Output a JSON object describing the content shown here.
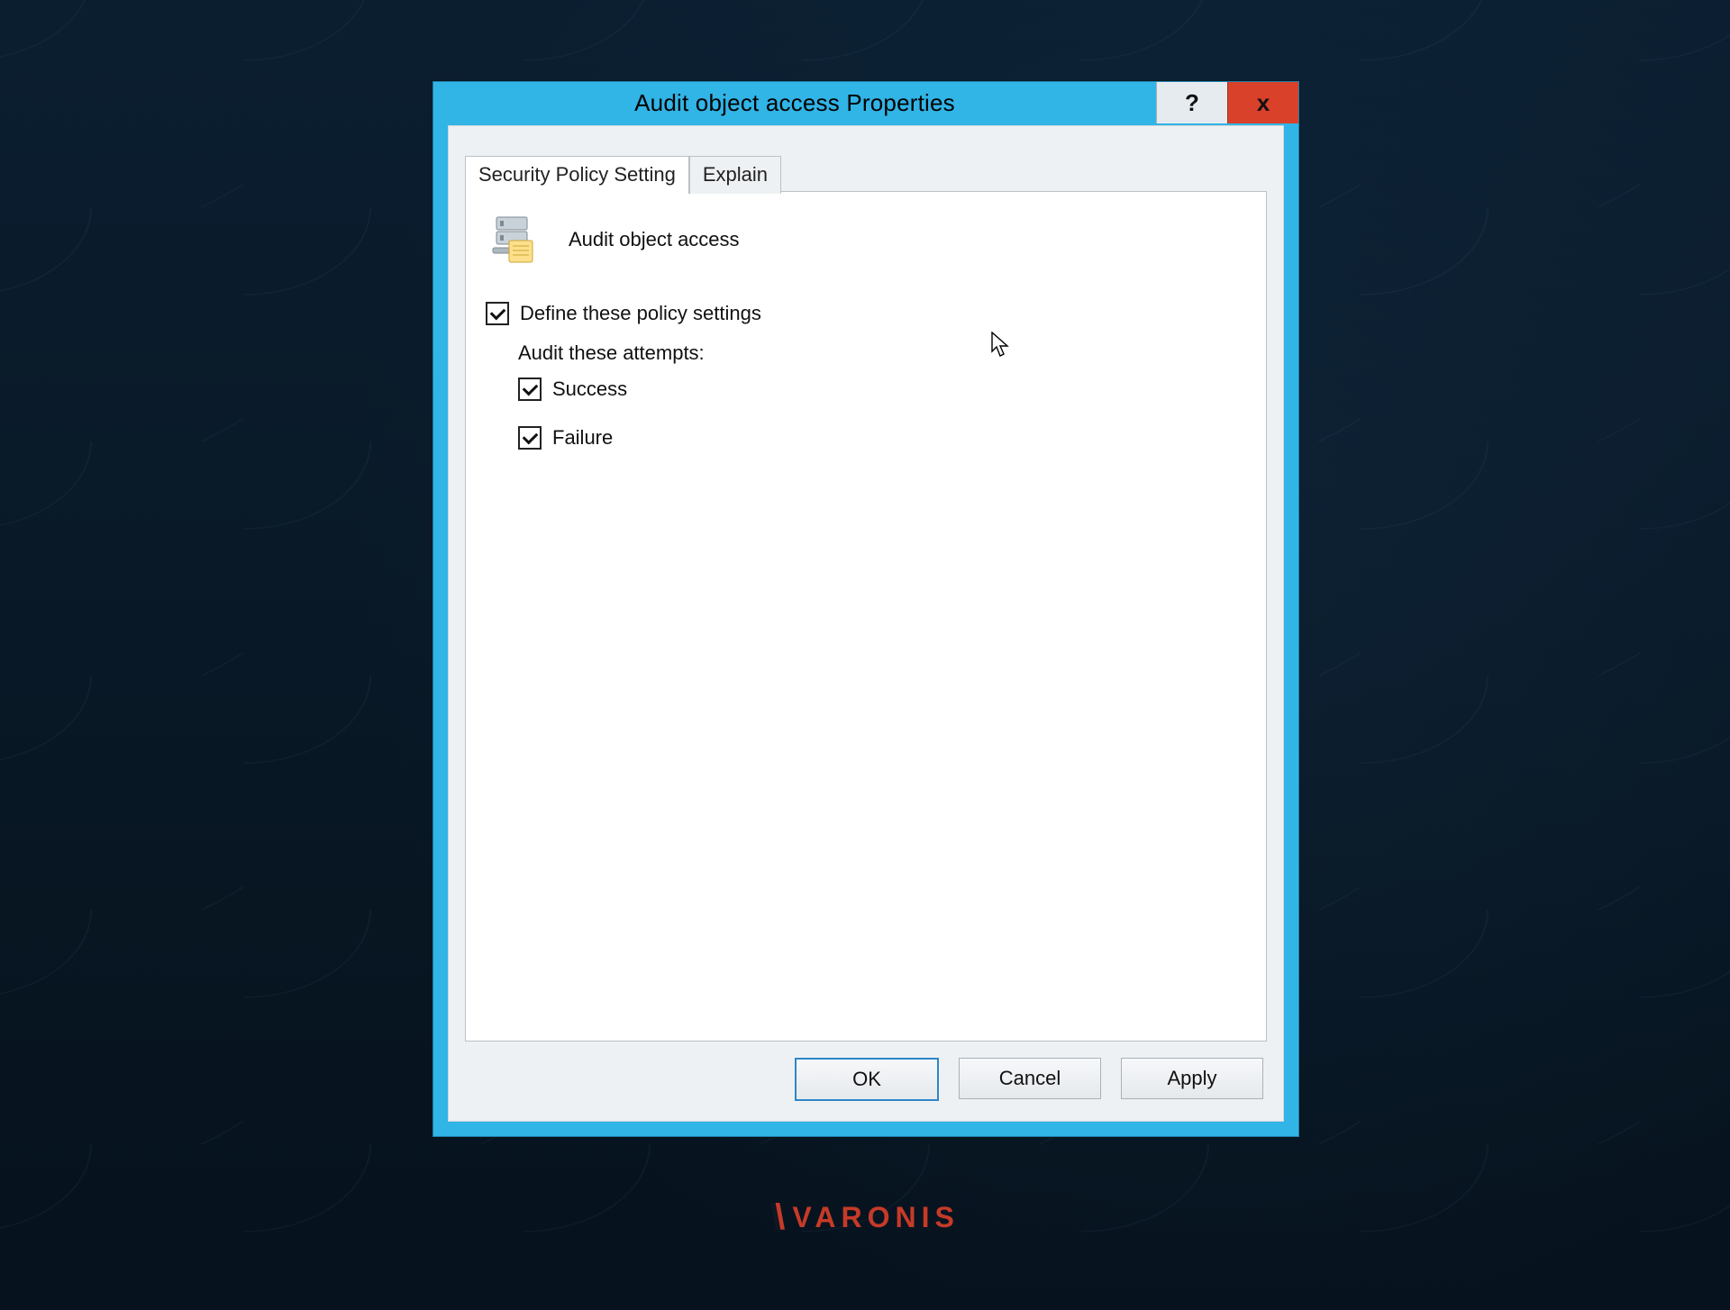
{
  "window": {
    "title": "Audit object access Properties",
    "help_label": "?",
    "close_label": "x"
  },
  "tabs": {
    "active": "Security Policy Setting",
    "items": [
      {
        "id": "security",
        "label": "Security Policy Setting"
      },
      {
        "id": "explain",
        "label": "Explain"
      }
    ]
  },
  "policy": {
    "name": "Audit object access",
    "define_label": "Define these policy settings",
    "define_checked": true,
    "attempts_heading": "Audit these attempts:",
    "success_label": "Success",
    "success_checked": true,
    "failure_label": "Failure",
    "failure_checked": true
  },
  "buttons": {
    "ok": "OK",
    "cancel": "Cancel",
    "apply": "Apply"
  },
  "brand": {
    "name": "VARONIS"
  }
}
